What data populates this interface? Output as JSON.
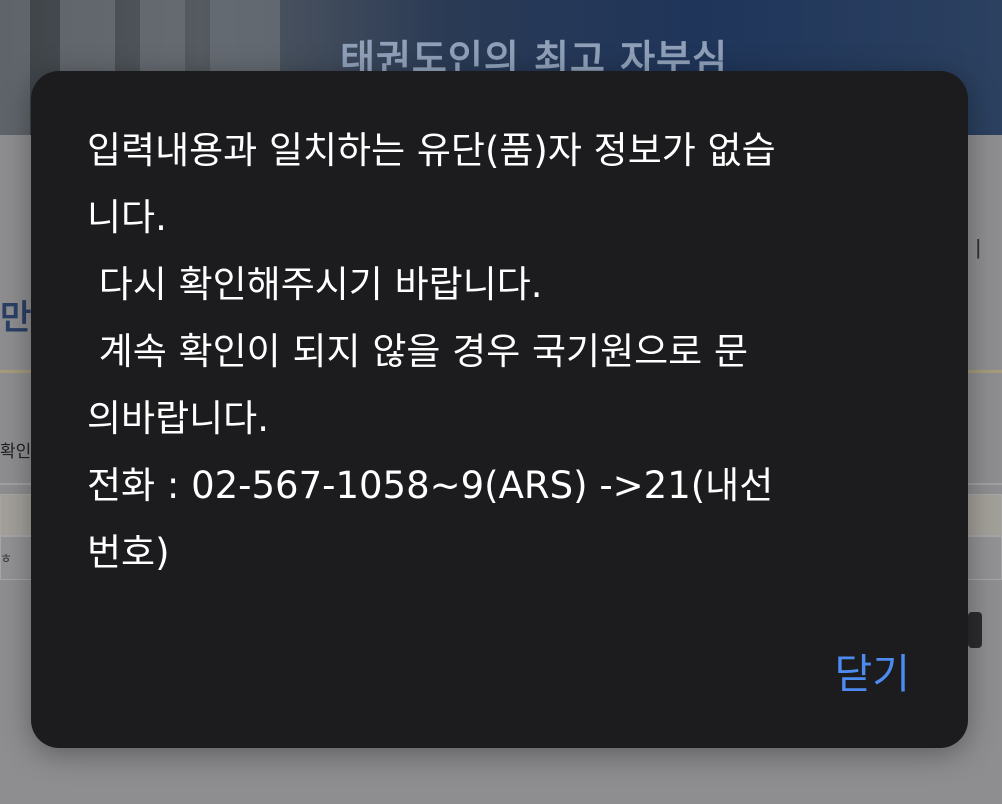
{
  "background": {
    "slogan": "태권도인의 최고 자부심",
    "title_fragment": "만 ㅊ",
    "label_fragment": "확인",
    "row_fragment": "ㅎ",
    "side_fragment": "ㅣ"
  },
  "dialog": {
    "message": "입력내용과 일치하는 유단(품)자 정보가 없습\n니다.\n 다시 확인해주시기 바랍니다.\n 계속 확인이 되지 않을 경우 국기원으로 문\n의바랍니다.\n전화 : 02-567-1058~9(ARS) ->21(내선\n번호)",
    "close_label": "닫기"
  },
  "colors": {
    "dialog_background": "#1c1c1e",
    "dialog_text": "#ffffff",
    "close_accent": "#4e8bf0",
    "dimmed_backdrop": "#8e8e90"
  }
}
